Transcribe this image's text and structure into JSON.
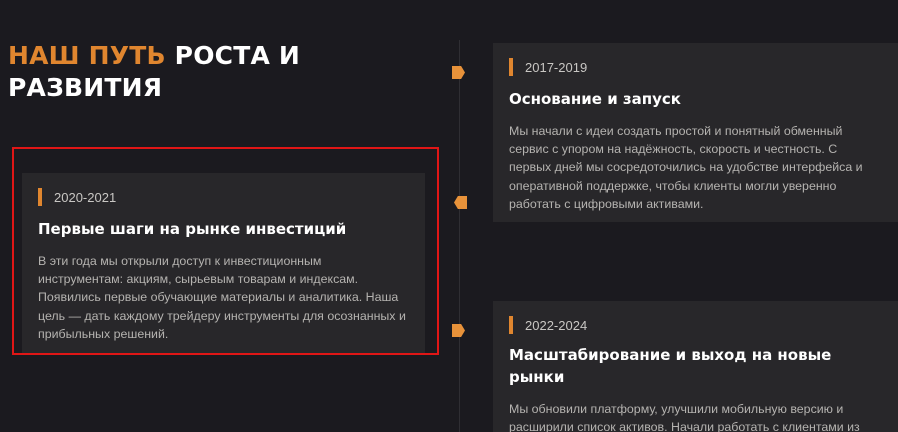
{
  "section": {
    "title_accent": "НАШ ПУТЬ",
    "title_rest_line1": " РОСТА И",
    "title_rest_line2": "РАЗВИТИЯ"
  },
  "colors": {
    "accent": "#e0862f",
    "background": "#1b1a1f",
    "card": "#28272a",
    "highlight_outline": "#e01616"
  },
  "timeline": [
    {
      "year": "2017-2019",
      "title": "Основание и запуск",
      "description": "Мы начали с идеи создать простой и понятный обменный сервис с упором на надёжность, скорость и честность. С первых дней мы сосредоточились на удобстве интерфейса и оперативной поддержке, чтобы клиенты могли уверенно работать с цифровыми активами."
    },
    {
      "year": "2020-2021",
      "title": "Первые шаги на рынке инвестиций",
      "description": "В эти года мы открыли доступ к инвестиционным инструментам: акциям, сырьевым товарам и индексам. Появились первые обучающие материалы и аналитика. Наша цель — дать каждому трейдеру инструменты для осознанных и прибыльных решений."
    },
    {
      "year": "2022-2024",
      "title": "Масштабирование и выход на новые рынки",
      "description": "Мы обновили платформу, улучшили мобильную версию и расширили список активов. Начали работать с клиентами из"
    }
  ]
}
